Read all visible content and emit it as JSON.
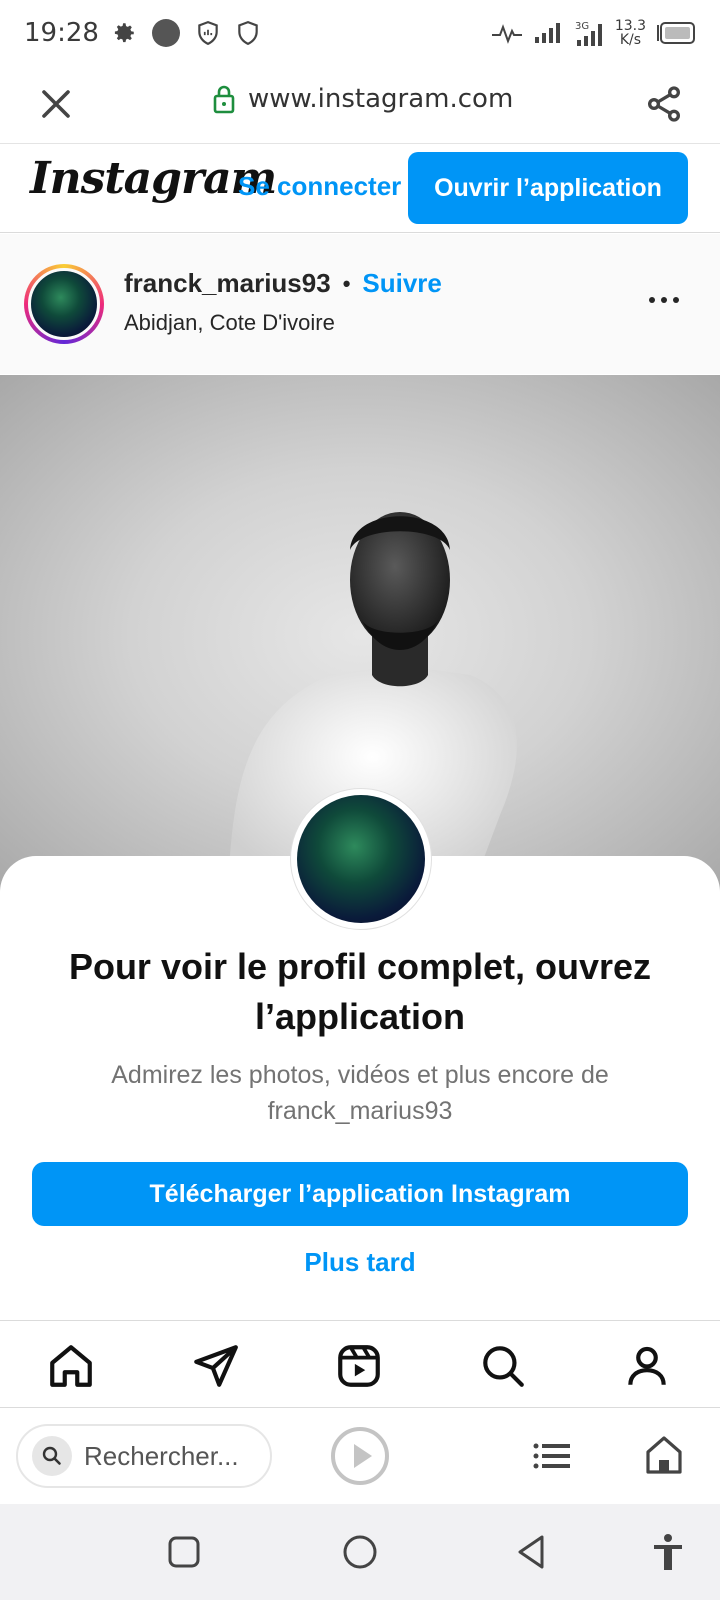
{
  "status_bar": {
    "time": "19:28",
    "speed_value": "13.3",
    "speed_unit": "K/s",
    "icons": [
      "gear-icon",
      "dot-icon",
      "shield-chart-icon",
      "shield-icon",
      "activity-icon",
      "signal-icon",
      "signal-3g-icon",
      "battery-icon"
    ]
  },
  "browser": {
    "url": "www.instagram.com",
    "icons": [
      "close-icon",
      "lock-icon",
      "share-icon"
    ]
  },
  "ig_header": {
    "logo": "Instagram",
    "login": "Se connecter",
    "open_app": "Ouvrir l’application"
  },
  "post": {
    "username": "franck_marius93",
    "separator": "•",
    "follow": "Suivre",
    "location": "Abidjan, Cote D'ivoire"
  },
  "modal": {
    "title": "Pour voir le profil complet, ouvrez l’application",
    "subtitle": "Admirez les photos, vidéos et plus encore de franck_marius93",
    "download": "Télécharger l’application Instagram",
    "later": "Plus tard"
  },
  "ig_nav": {
    "items": [
      "home-icon",
      "direct-icon",
      "reels-icon",
      "search-icon",
      "profile-icon"
    ]
  },
  "browser_bottom": {
    "search_placeholder": "Rechercher..."
  },
  "colors": {
    "accent": "#0095f6",
    "lock": "#1e8e3e"
  }
}
